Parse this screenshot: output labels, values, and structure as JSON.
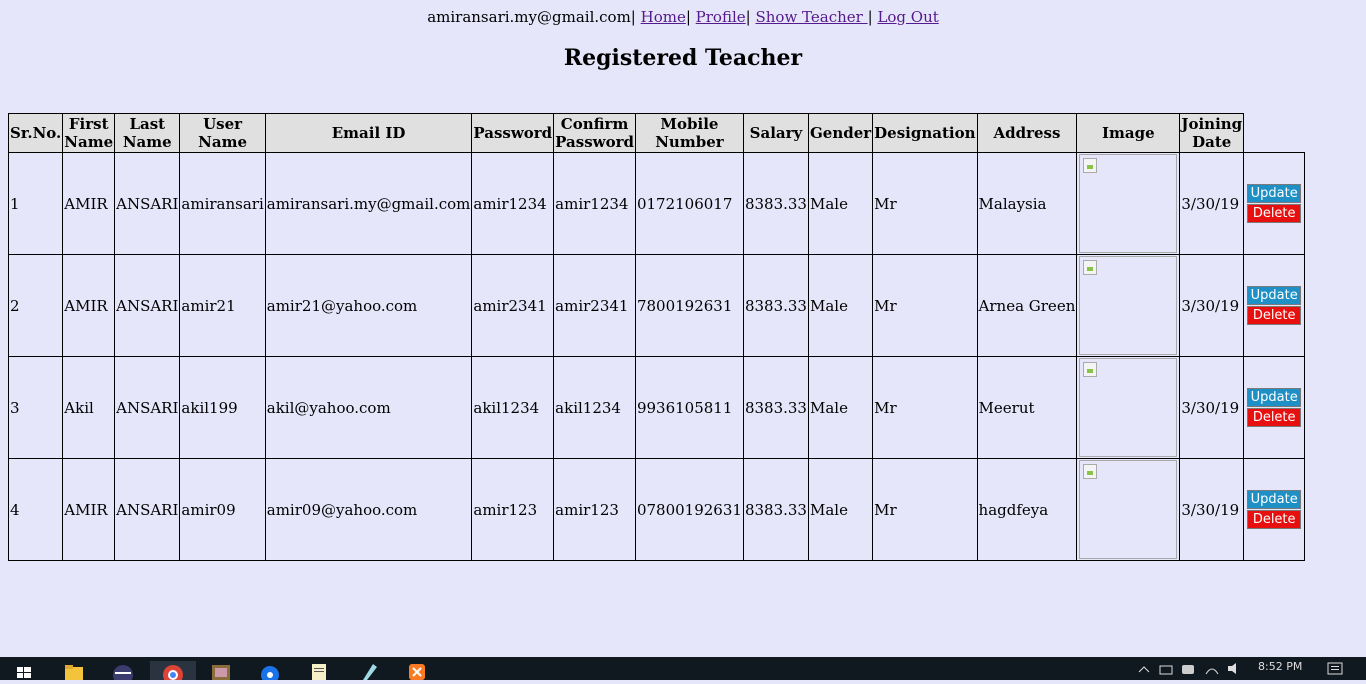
{
  "header": {
    "email": "amiransari.my@gmail.com",
    "links": [
      "Home",
      "Profile",
      "Show Teacher ",
      "Log Out"
    ]
  },
  "page_title": "Registered Teacher",
  "table": {
    "columns": [
      "Sr.No.",
      "First Name",
      "Last Name",
      "User Name",
      "Email ID",
      "Password",
      "Confirm Password",
      "Mobile Number",
      "Salary",
      "Gender",
      "Designation",
      "Address",
      "Image",
      "Joining Date"
    ],
    "rows": [
      {
        "sr": "1",
        "first": "AMIR",
        "last": "ANSARI",
        "user": "amiransari",
        "email": "amiransari.my@gmail.com",
        "password": "amir1234",
        "confirm": "amir1234",
        "mobile": "0172106017",
        "salary": "8383.33",
        "gender": "Male",
        "designation": "Mr",
        "address": "Malaysia",
        "joining": "3/30/19"
      },
      {
        "sr": "2",
        "first": "AMIR",
        "last": "ANSARI",
        "user": "amir21",
        "email": "amir21@yahoo.com",
        "password": "amir2341",
        "confirm": "amir2341",
        "mobile": "7800192631",
        "salary": "8383.33",
        "gender": "Male",
        "designation": "Mr",
        "address": "Arnea Green",
        "joining": "3/30/19"
      },
      {
        "sr": "3",
        "first": "Akil",
        "last": "ANSARI",
        "user": "akil199",
        "email": "akil@yahoo.com",
        "password": "akil1234",
        "confirm": "akil1234",
        "mobile": "9936105811",
        "salary": "8383.33",
        "gender": "Male",
        "designation": "Mr",
        "address": "Meerut",
        "joining": "3/30/19"
      },
      {
        "sr": "4",
        "first": "AMIR",
        "last": "ANSARI",
        "user": "amir09",
        "email": "amir09@yahoo.com",
        "password": "amir123",
        "confirm": "amir123",
        "mobile": "07800192631",
        "salary": "8383.33",
        "gender": "Male",
        "designation": "Mr",
        "address": "hagdfeya",
        "joining": "3/30/19"
      }
    ],
    "actions": {
      "update": "Update",
      "delete": "Delete"
    }
  },
  "taskbar": {
    "icons": [
      "windows-start-icon",
      "file-explorer-icon",
      "eclipse-icon",
      "chrome-icon",
      "app-icon",
      "app-icon",
      "notepad-icon",
      "app-icon",
      "xampp-icon"
    ],
    "clock": "8:52 PM"
  },
  "colors": {
    "background": "#e6e6fa",
    "update_button": "#1e90c6",
    "delete_button": "#e8100f",
    "header_cell": "#e0e0e0"
  }
}
